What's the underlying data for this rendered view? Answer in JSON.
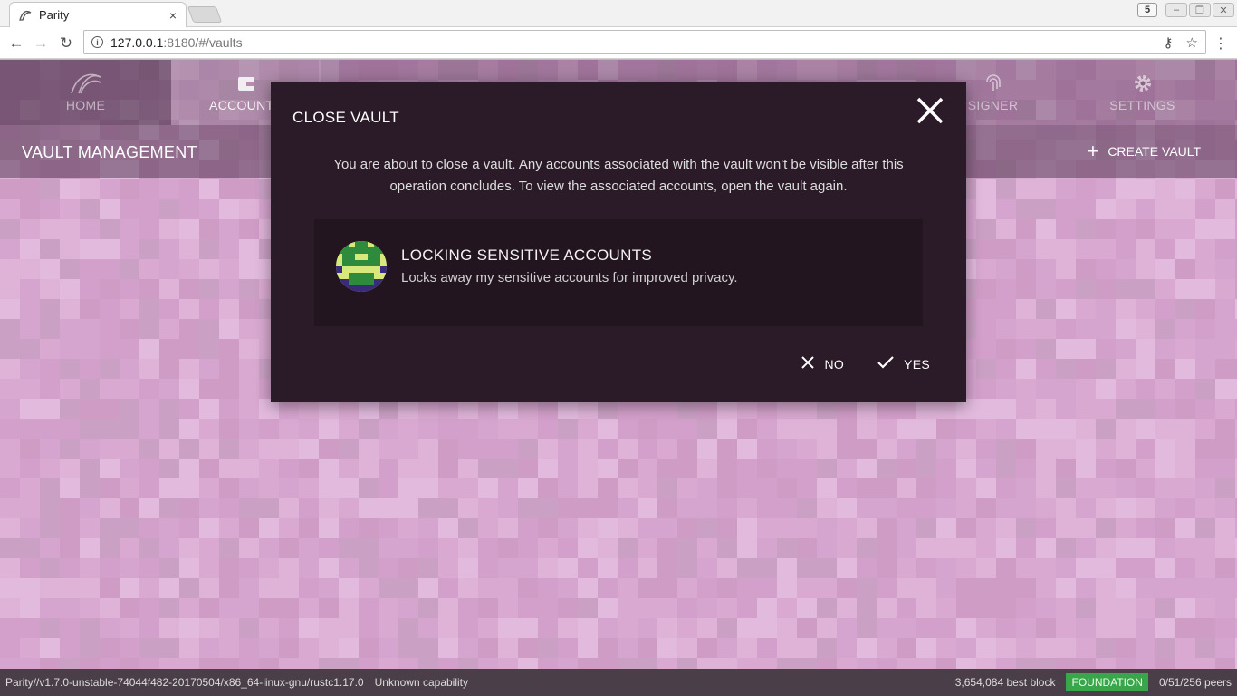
{
  "browser": {
    "tab_title": "Parity",
    "tab_close": "×",
    "ext_label": "5",
    "url_host": "127.0.0.1",
    "url_rest": ":8180/#/vaults",
    "info_glyph": "i"
  },
  "nav": {
    "items": [
      {
        "label": "HOME",
        "icon": "parity-logo-icon"
      },
      {
        "label": "ACCOUNTS",
        "icon": "wallet-icon"
      },
      {
        "label": "",
        "icon": "address-book-icon"
      },
      {
        "label": "",
        "icon": "apps-icon"
      },
      {
        "label": "",
        "icon": "contracts-icon"
      },
      {
        "label": "",
        "icon": "status-icon"
      },
      {
        "label": "SIGNER",
        "icon": "fingerprint-icon"
      },
      {
        "label": "SETTINGS",
        "icon": "gear-icon"
      }
    ]
  },
  "page": {
    "title": "VAULT MANAGEMENT",
    "create_vault_label": "CREATE VAULT"
  },
  "modal": {
    "title": "CLOSE VAULT",
    "body": "You are about to close a vault. Any accounts associated with the vault won't be visible after this operation concludes. To view the associated accounts, open the vault again.",
    "vault": {
      "name": "LOCKING SENSITIVE ACCOUNTS",
      "description": "Locks away my sensitive accounts for improved privacy."
    },
    "no_label": "NO",
    "yes_label": "YES"
  },
  "status": {
    "version": "Parity//v1.7.0-unstable-74044f482-20170504/x86_64-linux-gnu/rustc1.17.0",
    "capability": "Unknown capability",
    "best_block": "3,654,084 best block",
    "chain": "FOUNDATION",
    "peers": "0/51/256 peers"
  },
  "colors": {
    "background": "#d7a6cf",
    "modal": "#2b1a27",
    "statusbar": "#4a3f48",
    "badge": "#3aa64c"
  }
}
